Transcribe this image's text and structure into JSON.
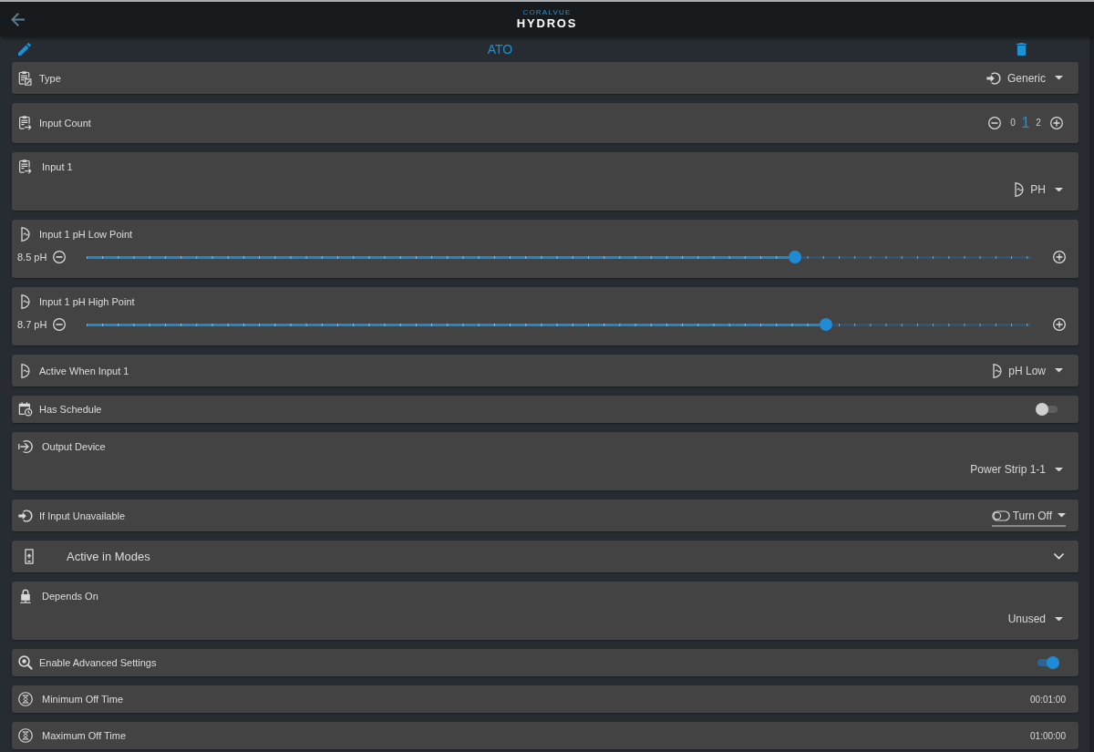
{
  "app_bar": {
    "brand_tagline": "CORALVUE",
    "brand": "HYDROS"
  },
  "title_bar": {
    "title": "ATO"
  },
  "settings": [
    {
      "kind": "select",
      "label": "Type",
      "value": "Generic"
    },
    {
      "kind": "stepper",
      "label": "Input Count",
      "options": [
        {
          "label": "0",
          "selected": false
        },
        {
          "label": "1",
          "selected": true
        },
        {
          "label": "2",
          "selected": false
        }
      ]
    },
    {
      "kind": "block",
      "label": "Input 1",
      "value": "PH"
    },
    {
      "kind": "slider",
      "label": "Input 1 pH Low Point",
      "reading": "8.5 pH",
      "level": 0.75
    },
    {
      "kind": "slider",
      "label": "Input 1 pH High Point",
      "reading": "8.7 pH",
      "level": 0.783
    },
    {
      "kind": "select",
      "label": "Active When Input 1",
      "value": "pH Low"
    },
    {
      "kind": "toggle",
      "label": "Has Schedule",
      "on": false
    },
    {
      "kind": "block",
      "label": "Output Device",
      "value": "Power Strip 1-1"
    },
    {
      "kind": "field",
      "label": "If Input Unavailable",
      "value": "Turn Off"
    },
    {
      "kind": "expander",
      "label": "Active in Modes",
      "expanded": false
    },
    {
      "kind": "block",
      "label": "Depends On",
      "value": "Unused"
    },
    {
      "kind": "toggle",
      "label": "Enable Advanced Settings",
      "on": true
    },
    {
      "kind": "time",
      "label": "Minimum Off Time",
      "value": "00:01:00"
    },
    {
      "kind": "time",
      "label": "Maximum Off Time",
      "value": "01:00:00"
    }
  ]
}
